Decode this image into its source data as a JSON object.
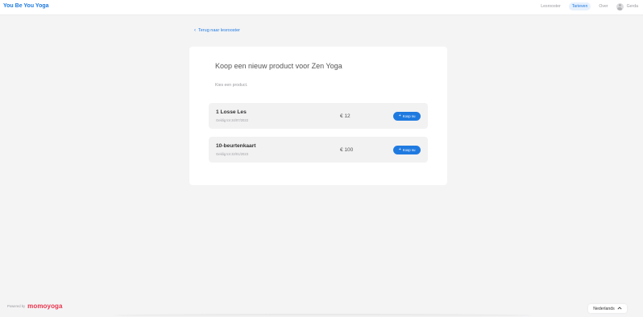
{
  "header": {
    "brand": "You Be You Yoga",
    "nav": [
      "Lesrooster",
      "Tarieven",
      "Over"
    ],
    "active_nav": "Tarieven",
    "user_name": "Gerda"
  },
  "back_link": "Terug naar lesrooster",
  "card": {
    "title": "Koop een nieuw product voor Zen Yoga",
    "subtitle": "Kies een product.",
    "products": [
      {
        "name": "1 Losse Les",
        "validity": "Geldig tot 24/07/2022",
        "price": "€ 12",
        "button": "Koop nu"
      },
      {
        "name": "10-beurtenkaart",
        "validity": "Geldig tot 22/01/2023",
        "price": "€ 100",
        "button": "Koop nu"
      }
    ]
  },
  "footer": {
    "powered_by": "Powered by",
    "logo": "momoyoga",
    "language": "Nederlands"
  },
  "icons": {
    "back": "chevron-left-icon",
    "user": "avatar-icon",
    "buy": "plus-icon",
    "language": "chevron-up-icon"
  },
  "colors": {
    "accent": "#1f7ae0",
    "logo": "#e8334a",
    "background": "#f4f4f5"
  }
}
